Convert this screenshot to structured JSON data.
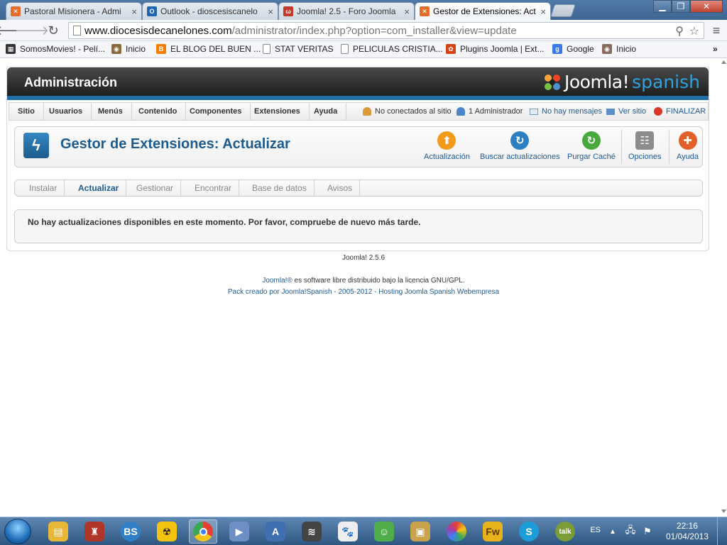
{
  "browser": {
    "tabs": [
      {
        "title": "Pastoral Misionera - Admi",
        "icon": "joomla-icon",
        "color": "#e36f2c"
      },
      {
        "title": "Outlook - dioscesiscanelo",
        "icon": "outlook-icon",
        "color": "#1f65b5"
      },
      {
        "title": "Joomla! 2.5 - Foro Joomla",
        "icon": "foro-icon",
        "color": "#c0392b"
      },
      {
        "title": "Gestor de Extensiones: Act",
        "icon": "joomla-icon",
        "color": "#e36f2c",
        "active": true
      }
    ],
    "url_host": "www.diocesisdecanelones.com",
    "url_path": "/administrator/index.php?option=com_installer&view=update",
    "bookmarks": [
      {
        "label": "SomosMovies! - Pelí...",
        "color": "#333333"
      },
      {
        "label": "Inicio",
        "color": "#8a6a3a"
      },
      {
        "label": "EL BLOG DEL BUEN ...",
        "color": "#f57d00"
      },
      {
        "label": "STAT VERITAS",
        "color": "#ffffff"
      },
      {
        "label": "PELICULAS CRISTIA...",
        "color": "#ffffff"
      },
      {
        "label": "Plugins Joomla | Ext...",
        "color": "#d84315"
      },
      {
        "label": "Google",
        "color": "#3b78e7"
      },
      {
        "label": "Inicio",
        "color": "#8a6a5a"
      }
    ],
    "bookmarks_more": "»"
  },
  "admin": {
    "header_title": "Administración",
    "logo_word": "Joomla!",
    "logo_spanish": "spanish",
    "menu": [
      "Sitio",
      "Usuarios",
      "Menús",
      "Contenido",
      "Componentes",
      "Extensiones",
      "Ayuda"
    ],
    "status": {
      "not_connected": "No conectados al sitio",
      "admins": "1 Administrador",
      "messages": "No hay mensajes",
      "view_site": "Ver sitio",
      "logout": "FINALIZAR"
    },
    "page_title": "Gestor de Extensiones: Actualizar",
    "toolbar": [
      {
        "label": "Actualización",
        "icon": "update-icon",
        "color": "#f29a1b"
      },
      {
        "label": "Buscar actualizaciones",
        "icon": "refresh-blue-icon",
        "color": "#2c7fc1"
      },
      {
        "label": "Purgar Caché",
        "icon": "refresh-green-icon",
        "color": "#4aa93d"
      },
      {
        "label": "Opciones",
        "icon": "options-icon",
        "color": "#8c8c8c"
      },
      {
        "label": "Ayuda",
        "icon": "help-icon",
        "color": "#e2612a"
      }
    ],
    "subnav": [
      {
        "label": "Instalar"
      },
      {
        "label": "Actualizar",
        "active": true
      },
      {
        "label": "Gestionar"
      },
      {
        "label": "Encontrar"
      },
      {
        "label": "Base de datos"
      },
      {
        "label": "Avisos"
      }
    ],
    "message": "No hay actualizaciones disponibles en este momento. Por favor, compruebe de nuevo más tarde."
  },
  "footer": {
    "version": "Joomla! 2.5.6",
    "license_link": "Joomla!®",
    "license_text": "es software libre distribuido bajo la licencia GNU/GPL.",
    "credit_link1": "Pack creado por Joomla!Spanish",
    "credit_sep": "- 2005-2012 -",
    "credit_link2": "Hosting Joomla Spanish Webempresa"
  },
  "taskbar": {
    "apps": [
      {
        "name": "explorer-icon",
        "color": "#e8b73a"
      },
      {
        "name": "game-icon",
        "color": "#b0362a"
      },
      {
        "name": "bs-player-icon",
        "color": "#2f7fc7"
      },
      {
        "name": "radiation-icon",
        "color": "#f2c40f"
      },
      {
        "name": "chrome-icon",
        "color": "#e34133",
        "active": true
      },
      {
        "name": "media-icon",
        "color": "#6e8fc4"
      },
      {
        "name": "app-a-icon",
        "color": "#3f6fb0"
      },
      {
        "name": "app-bars-icon",
        "color": "#444444"
      },
      {
        "name": "dog-icon",
        "color": "#eeeeee"
      },
      {
        "name": "messenger-icon",
        "color": "#4fae4a"
      },
      {
        "name": "photo-icon",
        "color": "#c9a24b"
      },
      {
        "name": "picasa-icon",
        "color": "#9c3fb0"
      },
      {
        "name": "fireworks-icon",
        "color": "#e8b21a"
      },
      {
        "name": "skype-icon",
        "color": "#1c9cd8"
      },
      {
        "name": "gtalk-icon",
        "color": "#7a9d3a"
      }
    ],
    "language": "ES",
    "time": "22:16",
    "date": "01/04/2013"
  }
}
